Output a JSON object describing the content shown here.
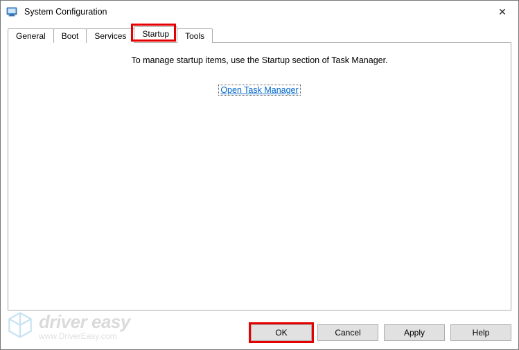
{
  "window": {
    "title": "System Configuration"
  },
  "tabs": {
    "items": [
      {
        "label": "General"
      },
      {
        "label": "Boot"
      },
      {
        "label": "Services"
      },
      {
        "label": "Startup"
      },
      {
        "label": "Tools"
      }
    ],
    "active_index": 3
  },
  "startup_pane": {
    "info": "To manage startup items, use the Startup section of Task Manager.",
    "link": "Open Task Manager"
  },
  "buttons": {
    "ok": "OK",
    "cancel": "Cancel",
    "apply": "Apply",
    "help": "Help"
  },
  "highlights": {
    "tab": "Startup",
    "button": "OK",
    "color": "#e60000"
  },
  "watermark": {
    "brand": "driver easy",
    "url": "www.DriverEasy.com"
  }
}
